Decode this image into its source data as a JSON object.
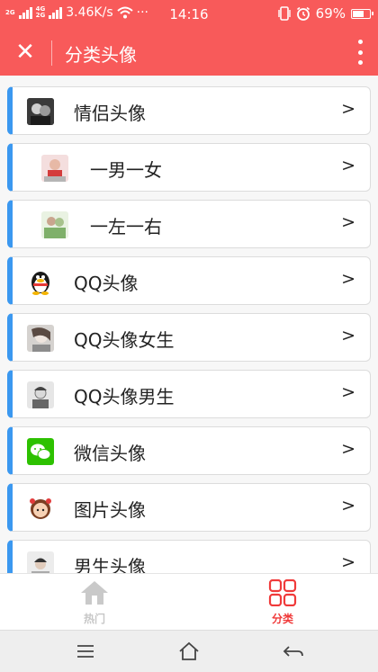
{
  "status_bar": {
    "network_top": "2G",
    "network_mid": "4G",
    "network_bot": "2G",
    "speed": "3.46K/s",
    "dots": "···",
    "time": "14:16",
    "battery": "69%",
    "battery_level": 0.69
  },
  "app_bar": {
    "close_glyph": "✕",
    "title": "分类头像"
  },
  "categories": [
    {
      "label": "情侣头像",
      "icon": "couple-avatar-thumbnail",
      "indent": false
    },
    {
      "label": "一男一女",
      "icon": "boy-girl-thumbnail",
      "indent": true
    },
    {
      "label": "一左一右",
      "icon": "left-right-thumbnail",
      "indent": true
    },
    {
      "label": "QQ头像",
      "icon": "qq-penguin-icon",
      "indent": false
    },
    {
      "label": "QQ头像女生",
      "icon": "qq-girl-thumbnail",
      "indent": false
    },
    {
      "label": "QQ头像男生",
      "icon": "qq-boy-thumbnail",
      "indent": false
    },
    {
      "label": "微信头像",
      "icon": "wechat-icon",
      "indent": false
    },
    {
      "label": "图片头像",
      "icon": "cartoon-girl-icon",
      "indent": false
    },
    {
      "label": "男生头像",
      "icon": "boy-thumbnail",
      "indent": false
    }
  ],
  "chevron": ">",
  "tabs": {
    "hot_label": "热门",
    "category_label": "分类",
    "active": "分类"
  },
  "colors": {
    "brand_red": "#f85a5a",
    "accent_blue": "#3b98f0",
    "tab_active": "#f03a3a",
    "tab_inactive": "#c7c7c7"
  }
}
